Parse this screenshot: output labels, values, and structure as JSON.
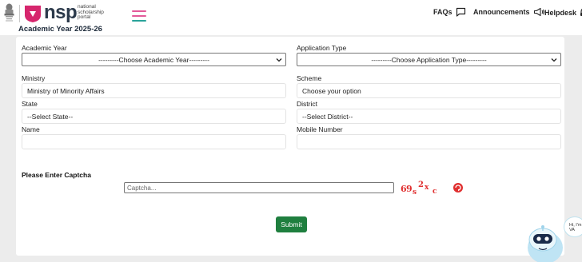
{
  "header": {
    "brand_name": "nsp",
    "brand_subtitle": "national scholarship portal",
    "academic_year_label": "Academic Year 2025-26",
    "nav": {
      "faqs": "FAQs",
      "announcements": "Announcements",
      "helpdesk": "Helpdesk"
    }
  },
  "form": {
    "academic_year": {
      "label": "Academic Year",
      "value": "---------Choose Academic Year---------"
    },
    "application_type": {
      "label": "Application Type",
      "value": "---------Choose Application Type---------"
    },
    "ministry": {
      "label": "Ministry",
      "value": "Ministry of Minority Affairs"
    },
    "scheme": {
      "label": "Scheme",
      "value": "Choose your option"
    },
    "state": {
      "label": "State",
      "value": "--Select State--"
    },
    "district": {
      "label": "District",
      "value": "--Select District--"
    },
    "name": {
      "label": "Name",
      "value": ""
    },
    "mobile": {
      "label": "Mobile Number",
      "value": ""
    },
    "captcha": {
      "label": "Please Enter Captcha",
      "placeholder": "Captcha...",
      "image_text": "69s2xc"
    },
    "submit_label": "Submit"
  },
  "chatbot": {
    "greeting": "Hi, I'm VA"
  },
  "colors": {
    "brand_pink": "#d6266d",
    "brand_dark": "#2c3a4b",
    "submit_green": "#1f7f3f",
    "captcha_red": "#e03030",
    "menu_pink": "#e35a9a",
    "menu_teal": "#2aa39a"
  },
  "icons": {
    "emblem": "national-emblem-icon",
    "faqs": "chat-bubble-icon",
    "announcements": "megaphone-icon",
    "helpdesk": "headset-icon",
    "refresh": "refresh-icon",
    "menu": "hamburger-menu-icon"
  }
}
